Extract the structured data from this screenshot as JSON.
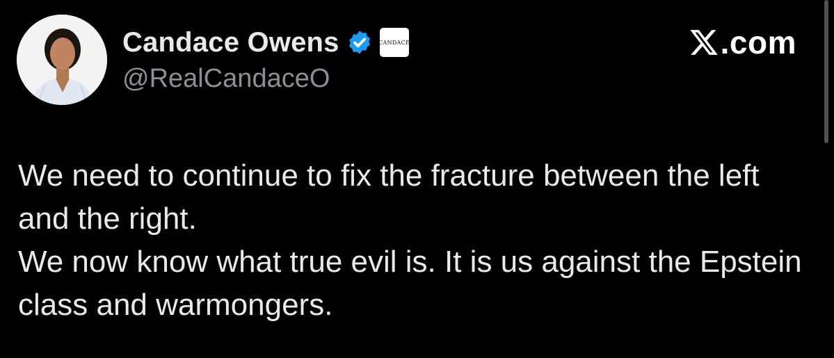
{
  "author": {
    "display_name": "Candace Owens",
    "handle": "@RealCandaceO",
    "affiliate_badge_text": "CANDACE",
    "avatar_icon": "profile-photo",
    "verified_icon": "verified-badge-icon"
  },
  "brand": {
    "logo_icon": "x-logo-icon",
    "text": ".com"
  },
  "tweet": {
    "paragraphs": [
      "We need to continue to fix the fracture between the left and the right.",
      "We now know what true evil is. It is us against the Epstein class and warmongers."
    ]
  },
  "colors": {
    "background": "#000000",
    "text": "#e7e9ea",
    "secondary_text": "#8b9096",
    "verified_blue": "#1d9bf0"
  }
}
